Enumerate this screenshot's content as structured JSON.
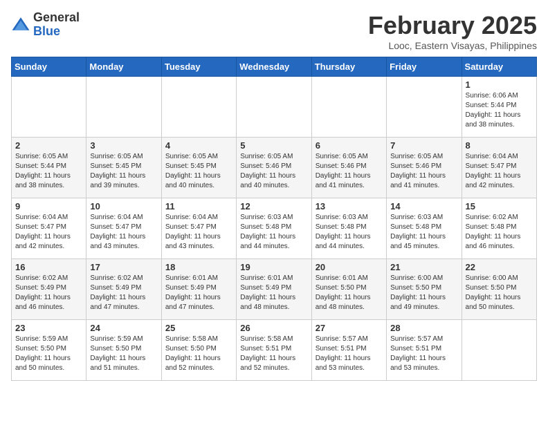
{
  "header": {
    "logo_general": "General",
    "logo_blue": "Blue",
    "month_title": "February 2025",
    "location": "Looc, Eastern Visayas, Philippines"
  },
  "days_of_week": [
    "Sunday",
    "Monday",
    "Tuesday",
    "Wednesday",
    "Thursday",
    "Friday",
    "Saturday"
  ],
  "weeks": [
    [
      {
        "day": "",
        "info": ""
      },
      {
        "day": "",
        "info": ""
      },
      {
        "day": "",
        "info": ""
      },
      {
        "day": "",
        "info": ""
      },
      {
        "day": "",
        "info": ""
      },
      {
        "day": "",
        "info": ""
      },
      {
        "day": "1",
        "info": "Sunrise: 6:06 AM\nSunset: 5:44 PM\nDaylight: 11 hours\nand 38 minutes."
      }
    ],
    [
      {
        "day": "2",
        "info": "Sunrise: 6:05 AM\nSunset: 5:44 PM\nDaylight: 11 hours\nand 38 minutes."
      },
      {
        "day": "3",
        "info": "Sunrise: 6:05 AM\nSunset: 5:45 PM\nDaylight: 11 hours\nand 39 minutes."
      },
      {
        "day": "4",
        "info": "Sunrise: 6:05 AM\nSunset: 5:45 PM\nDaylight: 11 hours\nand 40 minutes."
      },
      {
        "day": "5",
        "info": "Sunrise: 6:05 AM\nSunset: 5:46 PM\nDaylight: 11 hours\nand 40 minutes."
      },
      {
        "day": "6",
        "info": "Sunrise: 6:05 AM\nSunset: 5:46 PM\nDaylight: 11 hours\nand 41 minutes."
      },
      {
        "day": "7",
        "info": "Sunrise: 6:05 AM\nSunset: 5:46 PM\nDaylight: 11 hours\nand 41 minutes."
      },
      {
        "day": "8",
        "info": "Sunrise: 6:04 AM\nSunset: 5:47 PM\nDaylight: 11 hours\nand 42 minutes."
      }
    ],
    [
      {
        "day": "9",
        "info": "Sunrise: 6:04 AM\nSunset: 5:47 PM\nDaylight: 11 hours\nand 42 minutes."
      },
      {
        "day": "10",
        "info": "Sunrise: 6:04 AM\nSunset: 5:47 PM\nDaylight: 11 hours\nand 43 minutes."
      },
      {
        "day": "11",
        "info": "Sunrise: 6:04 AM\nSunset: 5:47 PM\nDaylight: 11 hours\nand 43 minutes."
      },
      {
        "day": "12",
        "info": "Sunrise: 6:03 AM\nSunset: 5:48 PM\nDaylight: 11 hours\nand 44 minutes."
      },
      {
        "day": "13",
        "info": "Sunrise: 6:03 AM\nSunset: 5:48 PM\nDaylight: 11 hours\nand 44 minutes."
      },
      {
        "day": "14",
        "info": "Sunrise: 6:03 AM\nSunset: 5:48 PM\nDaylight: 11 hours\nand 45 minutes."
      },
      {
        "day": "15",
        "info": "Sunrise: 6:02 AM\nSunset: 5:48 PM\nDaylight: 11 hours\nand 46 minutes."
      }
    ],
    [
      {
        "day": "16",
        "info": "Sunrise: 6:02 AM\nSunset: 5:49 PM\nDaylight: 11 hours\nand 46 minutes."
      },
      {
        "day": "17",
        "info": "Sunrise: 6:02 AM\nSunset: 5:49 PM\nDaylight: 11 hours\nand 47 minutes."
      },
      {
        "day": "18",
        "info": "Sunrise: 6:01 AM\nSunset: 5:49 PM\nDaylight: 11 hours\nand 47 minutes."
      },
      {
        "day": "19",
        "info": "Sunrise: 6:01 AM\nSunset: 5:49 PM\nDaylight: 11 hours\nand 48 minutes."
      },
      {
        "day": "20",
        "info": "Sunrise: 6:01 AM\nSunset: 5:50 PM\nDaylight: 11 hours\nand 48 minutes."
      },
      {
        "day": "21",
        "info": "Sunrise: 6:00 AM\nSunset: 5:50 PM\nDaylight: 11 hours\nand 49 minutes."
      },
      {
        "day": "22",
        "info": "Sunrise: 6:00 AM\nSunset: 5:50 PM\nDaylight: 11 hours\nand 50 minutes."
      }
    ],
    [
      {
        "day": "23",
        "info": "Sunrise: 5:59 AM\nSunset: 5:50 PM\nDaylight: 11 hours\nand 50 minutes."
      },
      {
        "day": "24",
        "info": "Sunrise: 5:59 AM\nSunset: 5:50 PM\nDaylight: 11 hours\nand 51 minutes."
      },
      {
        "day": "25",
        "info": "Sunrise: 5:58 AM\nSunset: 5:50 PM\nDaylight: 11 hours\nand 52 minutes."
      },
      {
        "day": "26",
        "info": "Sunrise: 5:58 AM\nSunset: 5:51 PM\nDaylight: 11 hours\nand 52 minutes."
      },
      {
        "day": "27",
        "info": "Sunrise: 5:57 AM\nSunset: 5:51 PM\nDaylight: 11 hours\nand 53 minutes."
      },
      {
        "day": "28",
        "info": "Sunrise: 5:57 AM\nSunset: 5:51 PM\nDaylight: 11 hours\nand 53 minutes."
      },
      {
        "day": "",
        "info": ""
      }
    ]
  ]
}
